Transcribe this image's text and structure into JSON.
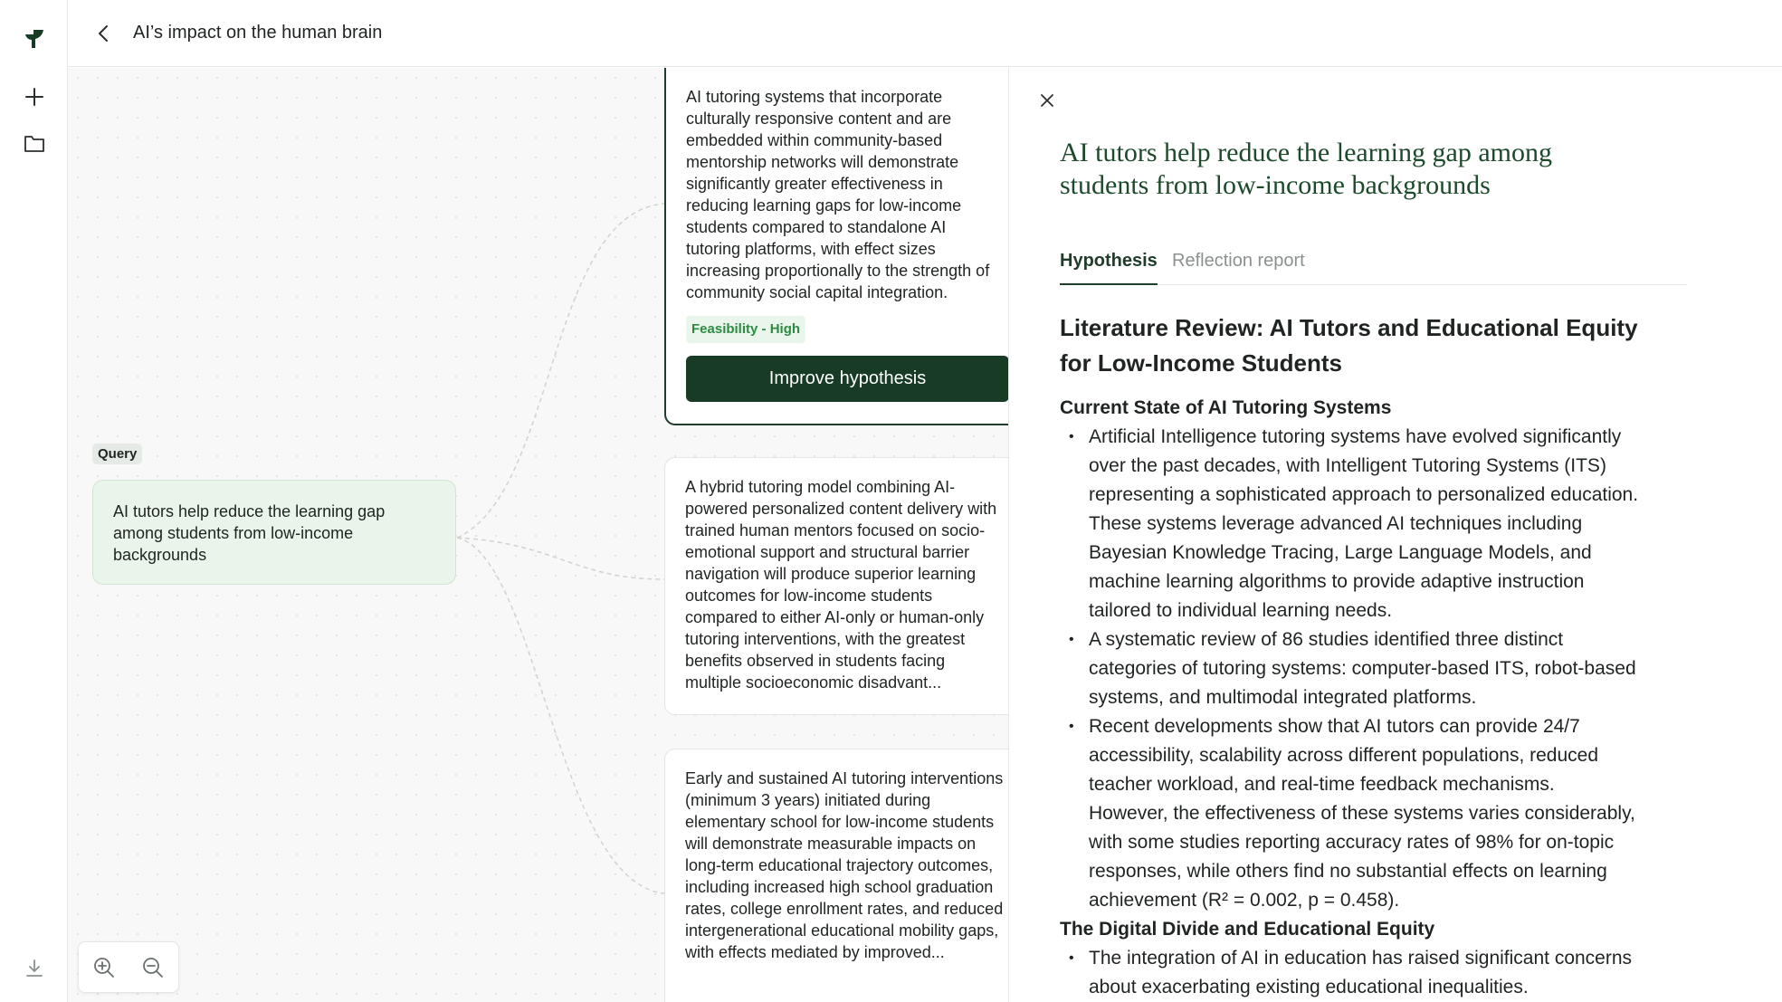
{
  "app": {
    "page_title": "AI’s impact on the human brain"
  },
  "sidebar": {
    "items": [
      {
        "name": "logo-icon",
        "icon": "leaf-logo"
      },
      {
        "name": "new-icon",
        "icon": "plus"
      },
      {
        "name": "folder-icon",
        "icon": "folder"
      },
      {
        "name": "download-icon",
        "icon": "download"
      }
    ]
  },
  "canvas": {
    "query_tag": "Query",
    "query_text": "AI tutors help reduce the learning gap among students from low-income backgrounds",
    "hypotheses": [
      {
        "text": "AI tutoring systems that incorporate culturally responsive content and are embedded within community-based mentorship networks will demonstrate significantly greater effectiveness in reducing learning gaps for low-income students compared to standalone AI tutoring platforms, with effect sizes increasing proportionally to the strength of community social capital integration.",
        "badge": "Feasibility - High",
        "button": "Improve hypothesis"
      },
      {
        "text": "A hybrid tutoring model combining AI-powered personalized content delivery with trained human mentors focused on socio-emotional support and structural barrier navigation will produce superior learning outcomes for low-income students compared to either AI-only or human-only tutoring interventions, with the greatest benefits observed in students facing multiple socioeconomic disadvant..."
      },
      {
        "text": "Early and sustained AI tutoring interventions (minimum 3 years) initiated during elementary school for low-income students will demonstrate measurable impacts on long-term educational trajectory outcomes, including increased high school graduation rates, college enrollment rates, and reduced intergenerational educational mobility gaps, with effects mediated by improved..."
      }
    ],
    "zoom": {
      "zoom_in_icon": "zoom-in",
      "zoom_out_icon": "zoom-out"
    }
  },
  "panel": {
    "title": "AI tutors help reduce the learning gap among students from low-income backgrounds",
    "tabs": [
      {
        "label": "Hypothesis",
        "active": true
      },
      {
        "label": "Reflection report",
        "active": false
      }
    ],
    "heading": "Literature Review: AI Tutors and Educational Equity for Low-Income Students",
    "sections": [
      {
        "title": "Current State of AI Tutoring Systems",
        "bullets": [
          "Artificial Intelligence tutoring systems have evolved significantly over the past decades, with Intelligent Tutoring Systems (ITS) representing a sophisticated approach to personalized education. These systems leverage advanced AI techniques including Bayesian Knowledge Tracing, Large Language Models, and machine learning algorithms to provide adaptive instruction tailored to individual learning needs.",
          "A systematic review of 86 studies identified three distinct categories of tutoring systems: computer-based ITS, robot-based systems, and multimodal integrated platforms.",
          "Recent developments show that AI tutors can provide 24/7 accessibility, scalability across different populations, reduced teacher workload, and real-time feedback mechanisms. However, the effectiveness of these systems varies considerably, with some studies reporting accuracy rates of 98% for on-topic responses, while others find no substantial effects on learning achievement (R² = 0.002, p = 0.458)."
        ]
      },
      {
        "title": "The Digital Divide and Educational Equity",
        "bullets": [
          "The integration of AI in education has raised significant concerns about exacerbating existing educational inequalities."
        ]
      }
    ]
  },
  "colors": {
    "accent_dark_green": "#173b24",
    "title_green": "#1e4a2c",
    "query_bg": "#e9f5ea",
    "badge_green": "#2e8a43"
  }
}
